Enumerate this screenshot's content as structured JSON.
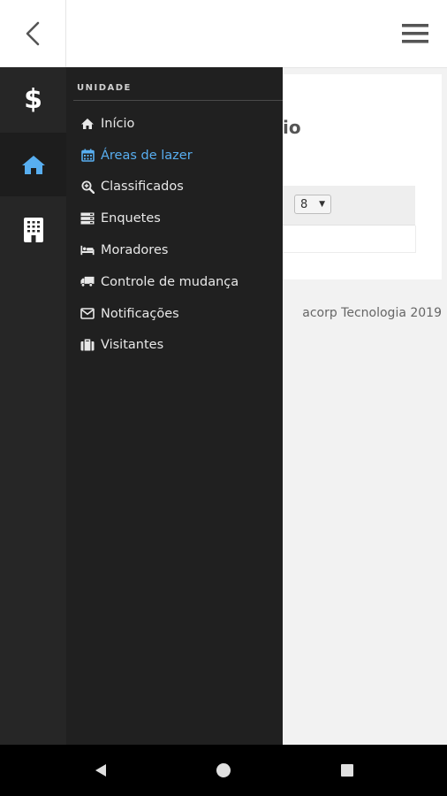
{
  "topbar": {
    "back_icon": "chevron-left-icon",
    "menu_icon": "hamburger-icon"
  },
  "background": {
    "title_partial": "io",
    "select_value": "8",
    "footer_partial": "acorp Tecnologia 2019"
  },
  "rail": {
    "items": [
      {
        "icon": "dollar-icon",
        "glyph": "$"
      },
      {
        "icon": "home-icon",
        "active": true
      },
      {
        "icon": "building-icon"
      }
    ]
  },
  "drawer": {
    "section_title": "UNIDADE",
    "accent": "#58aef0",
    "items": [
      {
        "label": "Início",
        "icon": "home-icon"
      },
      {
        "label": "Áreas de lazer",
        "icon": "calendar-icon",
        "active": true
      },
      {
        "label": "Classificados",
        "icon": "search-plus-icon"
      },
      {
        "label": "Enquetes",
        "icon": "server-icon"
      },
      {
        "label": "Moradores",
        "icon": "bed-icon"
      },
      {
        "label": "Controle de mudança",
        "icon": "truck-icon"
      },
      {
        "label": "Notificações",
        "icon": "envelope-icon"
      },
      {
        "label": "Visitantes",
        "icon": "briefcase-icon"
      }
    ]
  },
  "navbar": {
    "back": "triangle-back-icon",
    "home": "circle-home-icon",
    "recents": "square-recents-icon"
  }
}
